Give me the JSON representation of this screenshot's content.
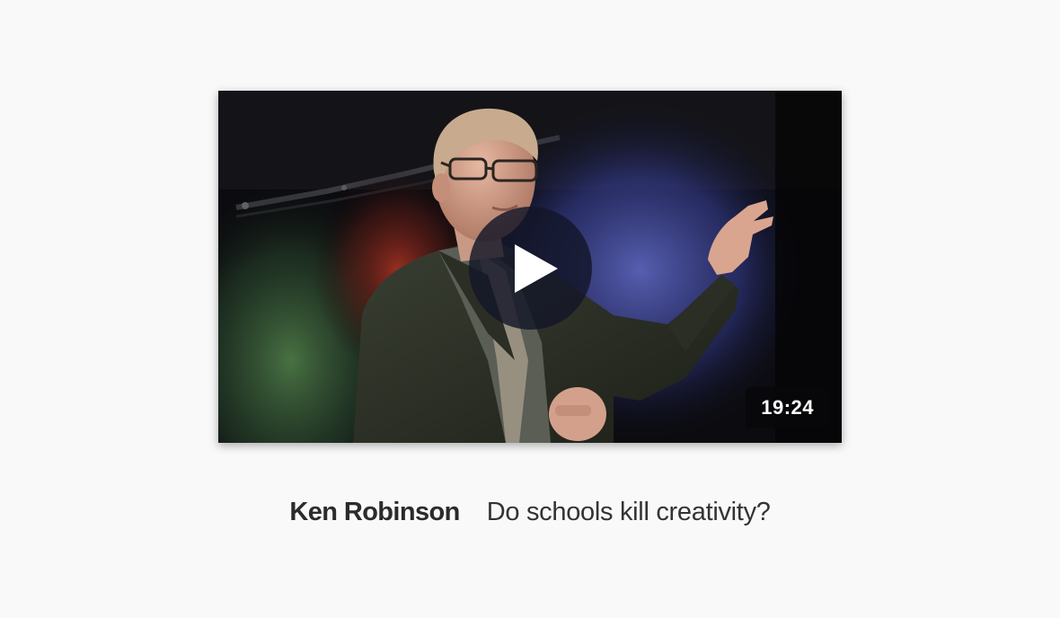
{
  "video": {
    "duration": "19:24",
    "thumbnail_alt": "Ken Robinson speaking on stage"
  },
  "talk": {
    "speaker": "Ken Robinson",
    "title": "Do schools kill creativity?"
  },
  "icons": {
    "play": "play-icon"
  },
  "colors": {
    "background": "#f9f9f9",
    "text": "#2b2b2b",
    "play_overlay": "#141628",
    "badge_background": "#08080a"
  }
}
